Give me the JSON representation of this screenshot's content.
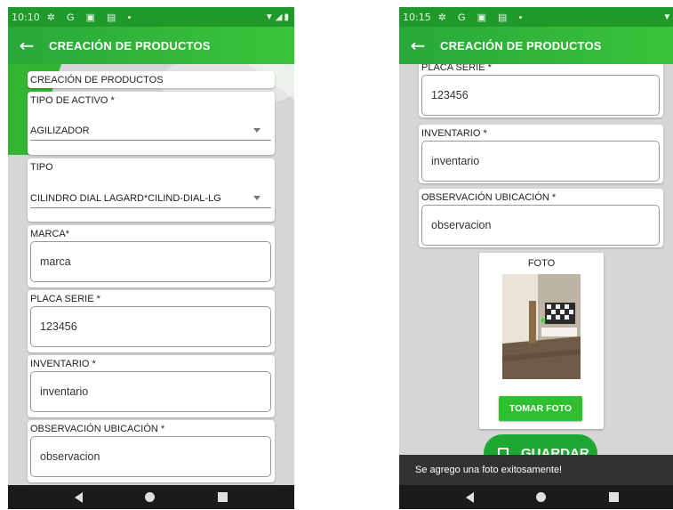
{
  "left_phone": {
    "status": {
      "time": "10:10",
      "icons": [
        "settings-icon",
        "google-icon",
        "image-icon",
        "sd-card-icon",
        "dot-icon"
      ],
      "right": "wifi-signal-battery"
    },
    "appbar": {
      "back": "←",
      "title": "CREACIÓN DE PRODUCTOS"
    },
    "header_card": "CREACIÓN DE PRODUCTOS",
    "tipo_activo": {
      "label": "TIPO DE ACTIVO *",
      "value": "AGILIZADOR"
    },
    "tipo": {
      "label": "TIPO",
      "value": "CILINDRO DIAL LAGARD*CILIND-DIAL-LG"
    },
    "marca": {
      "label": "MARCA*",
      "value": "marca"
    },
    "placa": {
      "label": "PLACA SERIE *",
      "value": "123456"
    },
    "inventario": {
      "label": "INVENTARIO *",
      "value": "inventario"
    },
    "observacion": {
      "label": "OBSERVACIÓN UBICACIÓN *",
      "value": "observacion"
    }
  },
  "right_phone": {
    "status": {
      "time": "10:15",
      "icons": [
        "settings-icon",
        "google-icon",
        "image-icon",
        "sd-card-icon",
        "dot-icon"
      ],
      "right": "wifi-signal"
    },
    "appbar": {
      "back": "←",
      "title": "CREACIÓN DE PRODUCTOS"
    },
    "placa": {
      "label": "PLACA SERIE *",
      "value": "123456"
    },
    "inventario": {
      "label": "INVENTARIO *",
      "value": "inventario"
    },
    "observacion": {
      "label": "OBSERVACIÓN UBICACIÓN *",
      "value": "observacion"
    },
    "foto": {
      "label": "FOTO",
      "button": "TOMAR FOTO"
    },
    "guardar": "GUARDAR",
    "snackbar": "Se agrego una foto exitosamente!"
  },
  "colors": {
    "primary_dark": "#1f9a2a",
    "primary": "#2fbf2f",
    "snackbar": "#323232"
  }
}
